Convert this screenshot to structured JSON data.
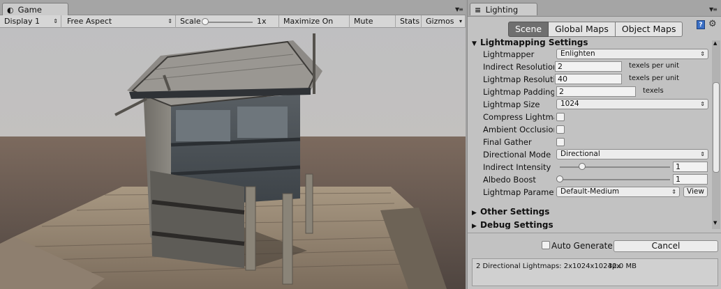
{
  "game": {
    "tab_label": "Game",
    "display": "Display 1",
    "aspect": "Free Aspect",
    "scale_label": "Scale",
    "scale_value": "1x",
    "maximize_on_play": "Maximize On Play",
    "mute_audio": "Mute Audio",
    "stats": "Stats",
    "gizmos": "Gizmos"
  },
  "lighting": {
    "tab_label": "Lighting",
    "tabs": [
      "Scene",
      "Global Maps",
      "Object Maps"
    ],
    "active_tab": "Scene",
    "lightmapping_settings": "Lightmapping Settings",
    "rows": {
      "lightmapper": {
        "label": "Lightmapper",
        "value": "Enlighten"
      },
      "indirect_resolution": {
        "label": "Indirect Resolution",
        "value": "2",
        "unit": "texels per unit"
      },
      "lightmap_resolution": {
        "label": "Lightmap Resolution",
        "value": "40",
        "unit": "texels per unit"
      },
      "lightmap_padding": {
        "label": "Lightmap Padding",
        "value": "2",
        "unit": "texels"
      },
      "lightmap_size": {
        "label": "Lightmap Size",
        "value": "1024"
      },
      "compress_lightmaps": {
        "label": "Compress Lightmaps",
        "checked": false
      },
      "ambient_occlusion": {
        "label": "Ambient Occlusion",
        "checked": false
      },
      "final_gather": {
        "label": "Final Gather",
        "checked": false
      },
      "directional_mode": {
        "label": "Directional Mode",
        "value": "Directional"
      },
      "indirect_intensity": {
        "label": "Indirect Intensity",
        "value": "1",
        "level": 0.2
      },
      "albedo_boost": {
        "label": "Albedo Boost",
        "value": "1",
        "level": 0.0
      },
      "lightmap_parameters": {
        "label": "Lightmap Parameters",
        "value": "Default-Medium",
        "button": "View"
      }
    },
    "other_settings": "Other Settings",
    "debug_settings": "Debug Settings",
    "auto_generate": "Auto Generate",
    "cancel": "Cancel",
    "info_lightmaps": "2 Directional Lightmaps: 2x1024x1024px",
    "info_size": "32.0 MB"
  },
  "icons": {
    "game_tab_icon": "unity-game-icon",
    "lighting_tab_icon": "lighting-icon",
    "help": "help-book-icon",
    "gear": "gear-icon"
  }
}
